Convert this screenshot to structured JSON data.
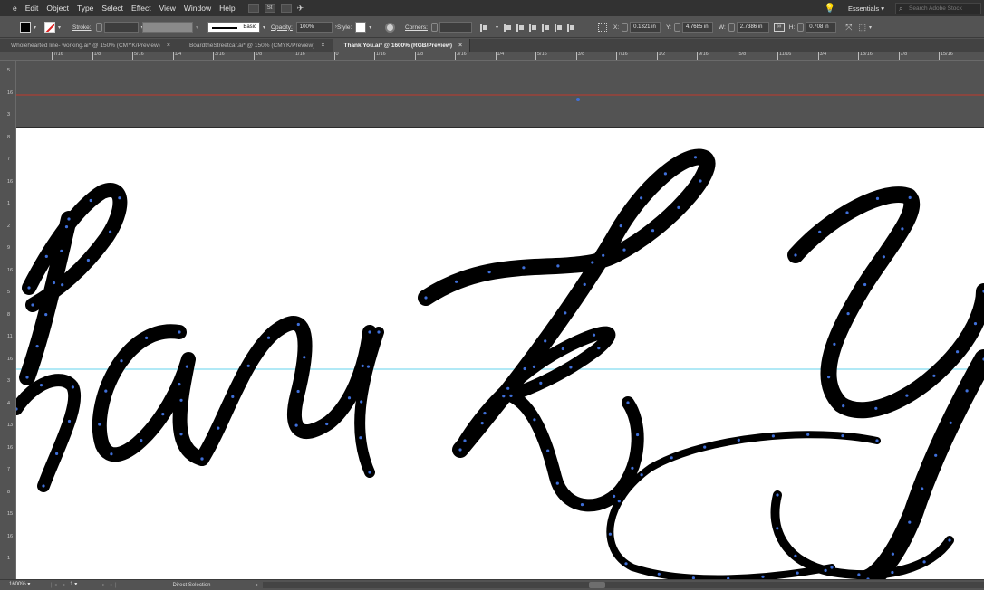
{
  "menu": [
    "e",
    "Edit",
    "Object",
    "Type",
    "Select",
    "Effect",
    "View",
    "Window",
    "Help"
  ],
  "menubar_icons": [
    "Br",
    "St",
    "arrange-documents",
    "gpu-performance"
  ],
  "workspace": "Essentials",
  "stock_search_placeholder": "Search Adobe Stock",
  "control": {
    "fill_color": "#000000",
    "stroke_label": "Stroke:",
    "stroke_profile": "Basic",
    "opacity_label": "Opacity:",
    "opacity_value": "100%",
    "style_label": "Style:",
    "corners_label": "Corners:",
    "x_label": "X:",
    "x_value": "0.1321 in",
    "y_label": "Y:",
    "y_value": "4.7685 in",
    "w_label": "W:",
    "w_value": "2.7386 in",
    "h_label": "H:",
    "h_value": "0.708 in"
  },
  "tabs": [
    {
      "label": "Wholehearted line- working.ai* @ 150% (CMYK/Preview)",
      "active": false
    },
    {
      "label": "BoardtheStreetcar.ai* @ 150% (CMYK/Preview)",
      "active": false
    },
    {
      "label": "Thank You.ai* @ 1600% (RGB/Preview)",
      "active": true
    }
  ],
  "tab_close": "×",
  "ruler_h": [
    "7/16",
    "1/8",
    "5/16",
    "1/4",
    "3/16",
    "1/8",
    "1/16",
    "0",
    "1/16",
    "1/8",
    "3/16",
    "1/4",
    "5/16",
    "3/8",
    "7/16",
    "1/2",
    "9/16",
    "5/8",
    "11/16",
    "3/4",
    "13/16",
    "7/8",
    "15/16"
  ],
  "ruler_v": [
    "5",
    "16",
    "3",
    "8",
    "7",
    "16",
    "1",
    "2",
    "9",
    "16",
    "5",
    "8",
    "11",
    "16",
    "3",
    "4",
    "13",
    "16",
    "7",
    "8",
    "15",
    "16",
    "1"
  ],
  "artwork_text": "hank Y",
  "status": {
    "zoom": "1600%",
    "page": "1",
    "tool": "Direct Selection"
  },
  "colors": {
    "guide_red": "#c0392b",
    "guide_cyan": "#63d3ee",
    "anchor_blue": "#3f6fd8"
  }
}
